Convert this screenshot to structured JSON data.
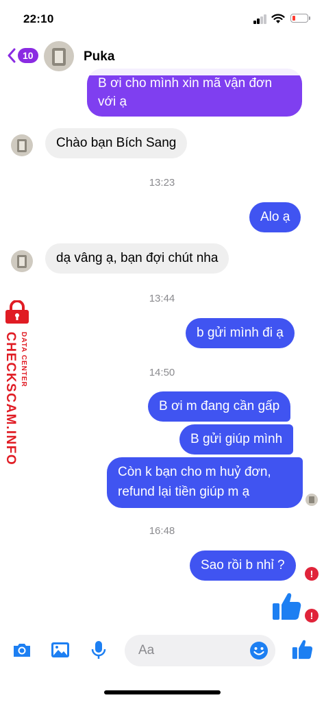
{
  "status_bar": {
    "time": "22:10",
    "battery_level": 0.15,
    "signal_bars": 2
  },
  "header": {
    "back_badge": "10",
    "contact_name": "Puka"
  },
  "messages": {
    "m1_line1": "B ơi cho mình xin mã vận đơn",
    "m1_line2": "với ạ",
    "m2": "Chào bạn Bích Sang",
    "t1": "13:23",
    "m3": "Alo ạ",
    "m4": "dạ vâng ạ, bạn đợi chút nha",
    "t2": "13:44",
    "m5": "b gửi mình đi ạ",
    "t3": "14:50",
    "m6": "B ơi m đang cần gấp",
    "m7": "B gửi giúp mình",
    "m8_line1": "Còn k bạn cho m huỷ đơn,",
    "m8_line2": "refund lại tiền giúp m ạ",
    "t4": "16:48",
    "m9": "Sao rồi b nhỉ ?",
    "error_mark": "!"
  },
  "watermark": {
    "brand": "CHECKSCAM.INFO",
    "sub": "DATA CENTER"
  },
  "composer": {
    "placeholder": "Aa"
  },
  "colors": {
    "outgoing": "#4054f1",
    "outgoing_purple": "#7f3ff0",
    "incoming": "#efefef",
    "accent": "#1d7ff2",
    "error": "#e0243a"
  },
  "icons": [
    "camera-icon",
    "image-icon",
    "microphone-icon",
    "emoji-icon",
    "like-icon",
    "back-chevron-icon",
    "error-icon"
  ]
}
